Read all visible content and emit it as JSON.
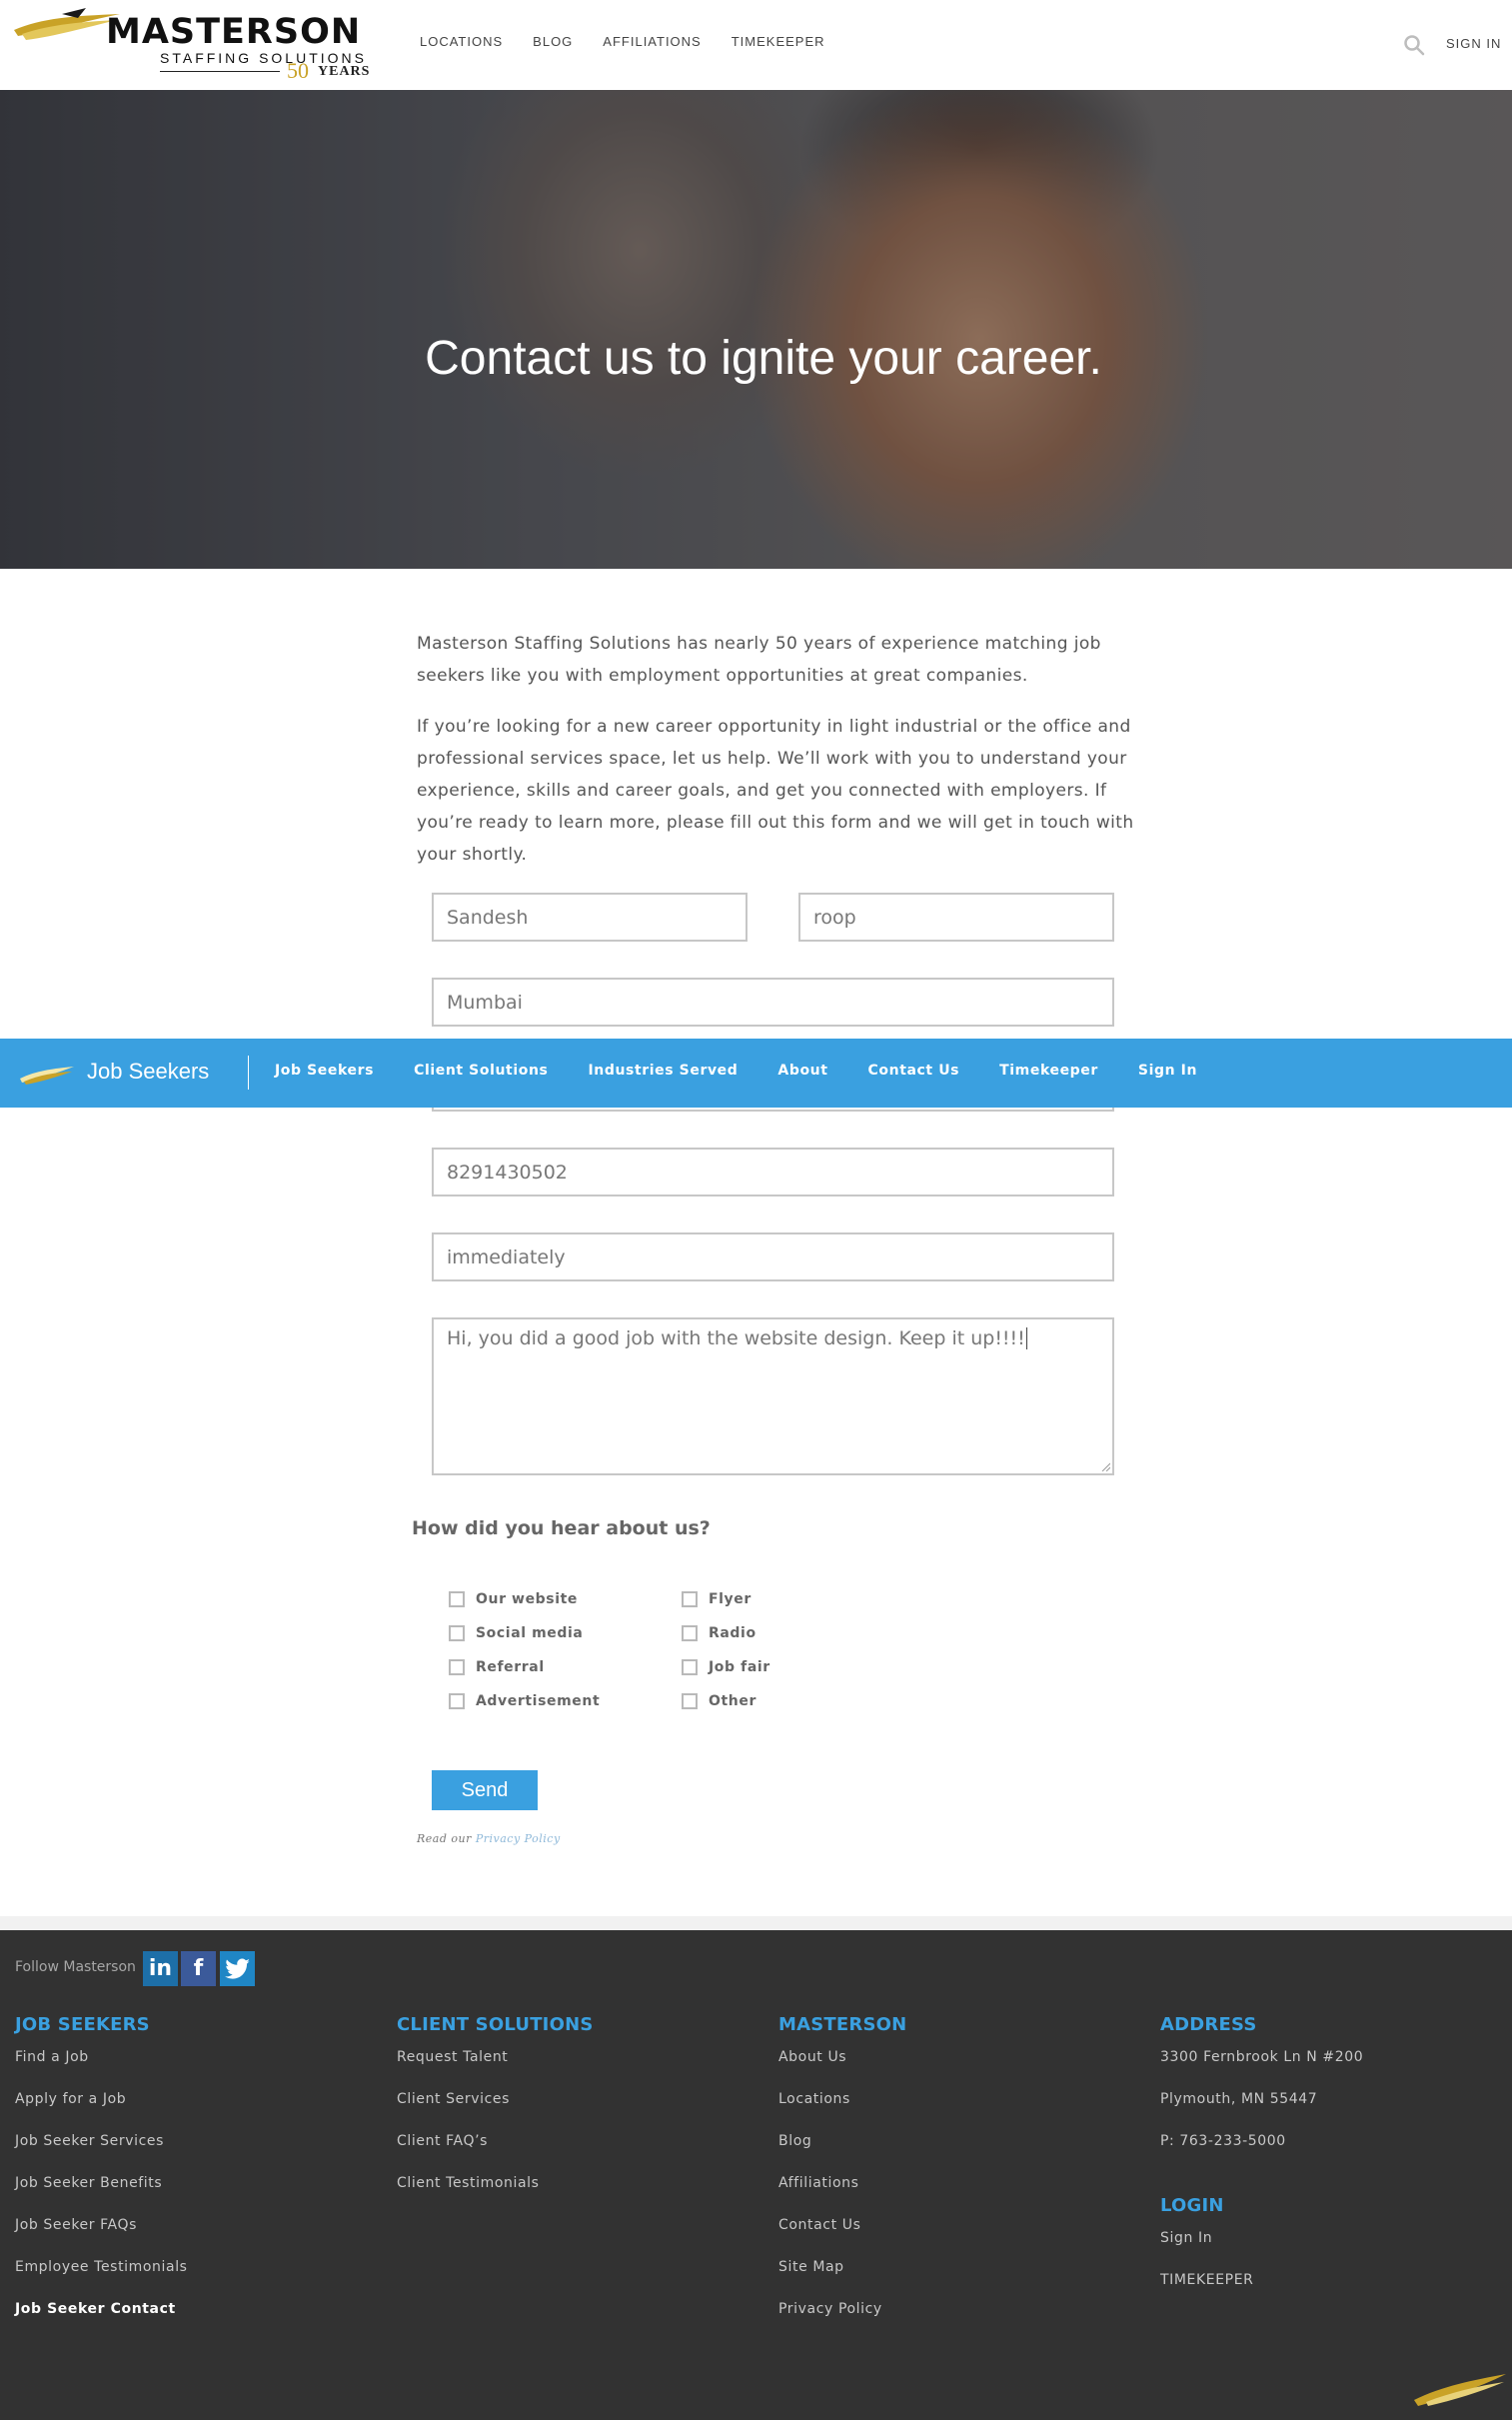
{
  "header": {
    "logo": {
      "name": "MASTERSON",
      "sub": "STAFFING SOLUTIONS",
      "fifty": "50",
      "years": "YEARS"
    },
    "nav": [
      "LOCATIONS",
      "BLOG",
      "AFFILIATIONS",
      "TIMEKEEPER"
    ],
    "sign_in": "SIGN IN",
    "search_icon": "search-icon"
  },
  "hero": {
    "title": "Contact us to ignite your career."
  },
  "intro": {
    "p1": "Masterson Staffing Solutions has nearly 50 years of experience matching job seekers like you with employment opportunities at great companies.",
    "p2": "If you’re looking for a new career opportunity in light industrial or the office and professional services space, let us help. We’ll work with you to understand your experience, skills and career goals, and get you connected with employers. If you’re ready to learn more, please fill out this form and we will get in touch with your shortly."
  },
  "form": {
    "first_name": "Sandesh",
    "last_name": "roop",
    "city": "Mumbai",
    "phone": "8291430502",
    "availability": "immediately",
    "message": "Hi, you did a good job with the website design. Keep it up!!!!",
    "send": "Send",
    "privacy_prefix": "Read our",
    "privacy_link": "Privacy Policy"
  },
  "sticky_bar": {
    "title": "Job Seekers",
    "nav": [
      "Job Seekers",
      "Client Solutions",
      "Industries Served",
      "About",
      "Contact Us",
      "Timekeeper",
      "Sign In"
    ]
  },
  "survey": {
    "question": "How did you hear about us?",
    "options_col1": [
      "Our website",
      "Social media",
      "Referral",
      "Advertisement"
    ],
    "options_col2": [
      "Flyer",
      "Radio",
      "Job fair",
      "Other"
    ]
  },
  "footer": {
    "follow": "Follow Masterson",
    "social": [
      "linkedin-icon",
      "facebook-icon",
      "twitter-icon"
    ],
    "columns": {
      "job_seekers": {
        "title": "JOB SEEKERS",
        "links": [
          "Find a Job",
          "Apply for a Job",
          "Job Seeker Services",
          "Job Seeker Benefits",
          "Job Seeker FAQs",
          "Employee Testimonials",
          "Job Seeker Contact"
        ]
      },
      "client_solutions": {
        "title": "CLIENT SOLUTIONS",
        "links": [
          "Request Talent",
          "Client Services",
          "Client FAQ’s",
          "Client Testimonials"
        ]
      },
      "masterson": {
        "title": "MASTERSON",
        "links": [
          "About Us",
          "Locations",
          "Blog",
          "Affiliations",
          "Contact Us",
          "Site Map",
          "Privacy Policy"
        ]
      },
      "address": {
        "title": "ADDRESS",
        "lines": [
          "3300 Fernbrook Ln N #200",
          "Plymouth, MN 55447",
          "P: 763-233-5000"
        ],
        "login_title": "LOGIN",
        "login_links": [
          "Sign In",
          "TIMEKEEPER"
        ]
      }
    }
  },
  "colors": {
    "accent": "#3aa0e0",
    "footer_bg": "#323232",
    "gold": "#c9a227"
  }
}
